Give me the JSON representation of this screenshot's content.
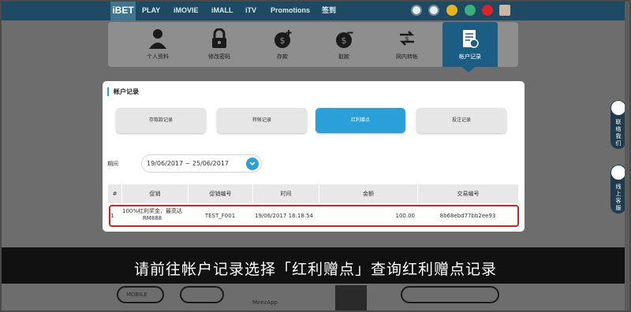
{
  "topnav": {
    "logo": "iBET",
    "links": [
      "PLAY",
      "iMOVIE",
      "iMALL",
      "iTV",
      "Promotions",
      "签到"
    ]
  },
  "account_menu": {
    "items": [
      {
        "label": "个人资料",
        "icon": "user-icon"
      },
      {
        "label": "修改密码",
        "icon": "lock-icon"
      },
      {
        "label": "存款",
        "icon": "deposit-icon"
      },
      {
        "label": "取款",
        "icon": "withdraw-icon"
      },
      {
        "label": "网内转帐",
        "icon": "transfer-icon"
      },
      {
        "label": "帐户记录",
        "icon": "records-icon"
      }
    ],
    "active_index": 5
  },
  "card": {
    "title": "帐户记录",
    "tabs": [
      "存取款记录",
      "转帐记录",
      "红利赠点",
      "投注记录"
    ],
    "active_tab": 2,
    "period_label": "期间",
    "date_range": "19/06/2017 ~ 25/06/2017"
  },
  "table": {
    "headers": [
      "#",
      "促销",
      "促销编号",
      "时间",
      "金额",
      "交易编号"
    ],
    "rows": [
      {
        "index": "1",
        "promo_line1": "100%红利奖金，最高达",
        "promo_line2": "RM888",
        "promo_code": "TEST_F001",
        "time": "19/06/2017 18:18:54",
        "amount": "100.00",
        "transaction_id": "8b68ebd77bb2ee93"
      }
    ]
  },
  "side_widgets": [
    {
      "label": "联络我们",
      "icon": "headset-icon"
    },
    {
      "label": "线上客服",
      "icon": "chat-icon"
    }
  ],
  "background": {
    "pill1": "MOBILE",
    "mid_text": "MeezApp"
  },
  "caption": "请前往帐户记录选择「红利赠点」查询红利赠点记录",
  "colors": {
    "accent": "#2b9fd8",
    "nav": "#1f4a63",
    "highlight": "#e21b1b"
  }
}
